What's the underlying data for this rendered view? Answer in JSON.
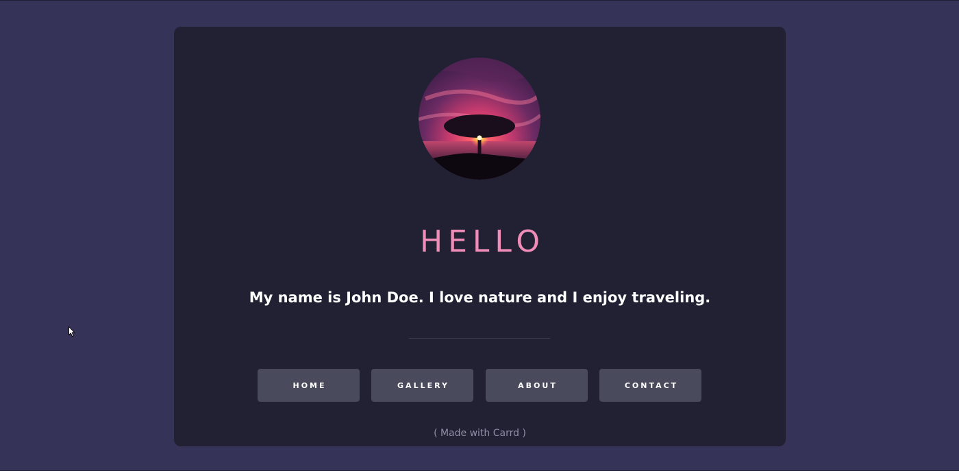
{
  "colors": {
    "page_background": "#353357",
    "card_background": "#212133",
    "heading_accent": "#f08cb8",
    "button_background": "#4a4a5d",
    "footer_text": "#8e8ea6"
  },
  "profile": {
    "avatar": "sunset-tree-photo"
  },
  "header": {
    "title": "HELLO"
  },
  "bio": {
    "text": "My name is John Doe. I love nature and I enjoy traveling."
  },
  "nav": {
    "items": [
      {
        "label": "HOME"
      },
      {
        "label": "GALLERY"
      },
      {
        "label": "ABOUT"
      },
      {
        "label": "CONTACT"
      }
    ]
  },
  "footer": {
    "credit": "( Made with Carrd )"
  }
}
